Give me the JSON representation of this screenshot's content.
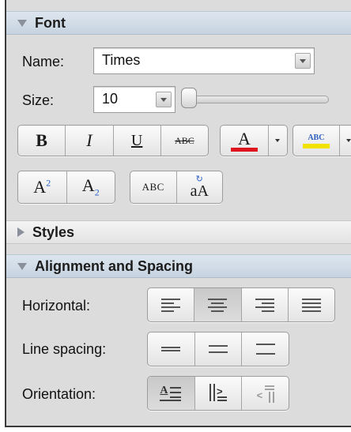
{
  "font_section": {
    "title": "Font",
    "name_label": "Name:",
    "name_value": "Times",
    "size_label": "Size:",
    "size_value": "10",
    "bold": "B",
    "italic": "I",
    "underline": "U",
    "strike": "ABC",
    "font_color_glyph": "A",
    "font_color": "#e0141e",
    "highlight_glyph": "ABC",
    "highlight_color": "#f2e200",
    "superscript_base": "A",
    "superscript_mark": "2",
    "subscript_base": "A",
    "subscript_mark": "2",
    "small_caps": "ABC",
    "change_case_small": "a",
    "change_case_big": "A"
  },
  "styles_section": {
    "title": "Styles"
  },
  "alignment_section": {
    "title": "Alignment and Spacing",
    "horizontal_label": "Horizontal:",
    "horizontal_selected": "center",
    "line_spacing_label": "Line spacing:",
    "orientation_label": "Orientation:",
    "orientation_selected": "horizontal"
  }
}
